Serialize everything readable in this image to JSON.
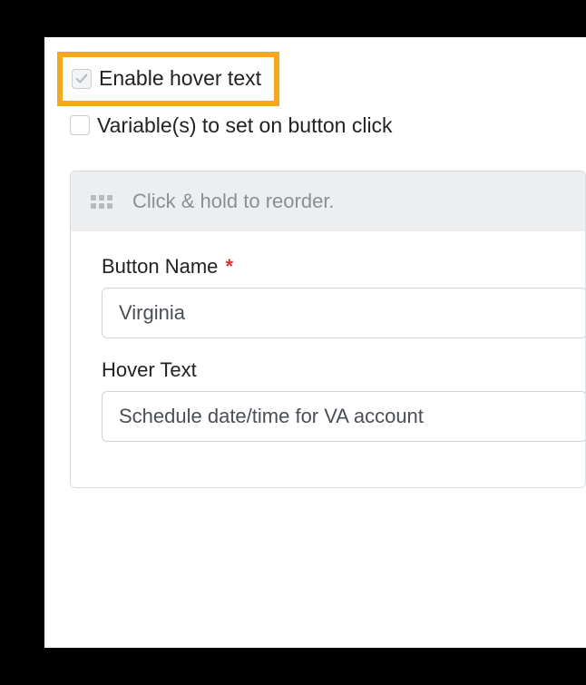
{
  "options": {
    "enable_hover_text": {
      "label": "Enable hover text",
      "checked": true
    },
    "variables_on_click": {
      "label": "Variable(s) to set on button click",
      "checked": false
    }
  },
  "panel": {
    "reorder_hint": "Click & hold to reorder."
  },
  "fields": {
    "button_name": {
      "label": "Button Name",
      "required_marker": "*",
      "value": "Virginia"
    },
    "hover_text": {
      "label": "Hover Text",
      "value": "Schedule date/time for VA account"
    }
  }
}
